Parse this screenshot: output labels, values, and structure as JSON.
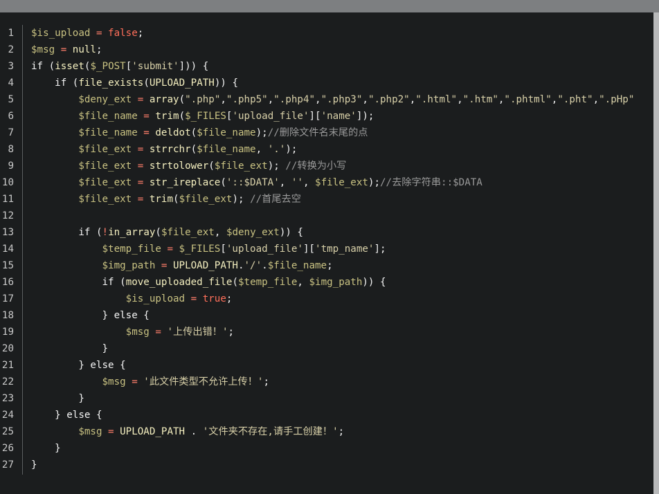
{
  "lines": [
    {
      "n": "1",
      "tokens": [
        {
          "t": "var",
          "v": "$is_upload"
        },
        {
          "t": "op",
          "v": " = "
        },
        {
          "t": "lit",
          "v": "false"
        },
        {
          "t": "pn",
          "v": ";"
        }
      ]
    },
    {
      "n": "2",
      "tokens": [
        {
          "t": "var",
          "v": "$msg"
        },
        {
          "t": "op",
          "v": " = "
        },
        {
          "t": "fn",
          "v": "null"
        },
        {
          "t": "pn",
          "v": ";"
        }
      ]
    },
    {
      "n": "3",
      "tokens": [
        {
          "t": "kw",
          "v": "if"
        },
        {
          "t": "pn",
          "v": " ("
        },
        {
          "t": "fn",
          "v": "isset"
        },
        {
          "t": "pn",
          "v": "("
        },
        {
          "t": "var",
          "v": "$_POST"
        },
        {
          "t": "pn",
          "v": "["
        },
        {
          "t": "str",
          "v": "'submit'"
        },
        {
          "t": "pn",
          "v": "])) {"
        }
      ]
    },
    {
      "n": "4",
      "tokens": [
        {
          "t": "pn",
          "v": "    "
        },
        {
          "t": "kw",
          "v": "if"
        },
        {
          "t": "pn",
          "v": " ("
        },
        {
          "t": "fn",
          "v": "file_exists"
        },
        {
          "t": "pn",
          "v": "("
        },
        {
          "t": "fn",
          "v": "UPLOAD_PATH"
        },
        {
          "t": "pn",
          "v": ")) {"
        }
      ]
    },
    {
      "n": "5",
      "tokens": [
        {
          "t": "pn",
          "v": "        "
        },
        {
          "t": "var",
          "v": "$deny_ext"
        },
        {
          "t": "op",
          "v": " = "
        },
        {
          "t": "fn",
          "v": "array"
        },
        {
          "t": "pn",
          "v": "("
        },
        {
          "t": "str",
          "v": "\".php\""
        },
        {
          "t": "pn",
          "v": ","
        },
        {
          "t": "str",
          "v": "\".php5\""
        },
        {
          "t": "pn",
          "v": ","
        },
        {
          "t": "str",
          "v": "\".php4\""
        },
        {
          "t": "pn",
          "v": ","
        },
        {
          "t": "str",
          "v": "\".php3\""
        },
        {
          "t": "pn",
          "v": ","
        },
        {
          "t": "str",
          "v": "\".php2\""
        },
        {
          "t": "pn",
          "v": ","
        },
        {
          "t": "str",
          "v": "\".html\""
        },
        {
          "t": "pn",
          "v": ","
        },
        {
          "t": "str",
          "v": "\".htm\""
        },
        {
          "t": "pn",
          "v": ","
        },
        {
          "t": "str",
          "v": "\".phtml\""
        },
        {
          "t": "pn",
          "v": ","
        },
        {
          "t": "str",
          "v": "\".pht\""
        },
        {
          "t": "pn",
          "v": ","
        },
        {
          "t": "str",
          "v": "\".pHp\""
        }
      ]
    },
    {
      "n": "6",
      "tokens": [
        {
          "t": "pn",
          "v": "        "
        },
        {
          "t": "var",
          "v": "$file_name"
        },
        {
          "t": "op",
          "v": " = "
        },
        {
          "t": "fn",
          "v": "trim"
        },
        {
          "t": "pn",
          "v": "("
        },
        {
          "t": "var",
          "v": "$_FILES"
        },
        {
          "t": "pn",
          "v": "["
        },
        {
          "t": "str",
          "v": "'upload_file'"
        },
        {
          "t": "pn",
          "v": "]["
        },
        {
          "t": "str",
          "v": "'name'"
        },
        {
          "t": "pn",
          "v": "]);"
        }
      ]
    },
    {
      "n": "7",
      "tokens": [
        {
          "t": "pn",
          "v": "        "
        },
        {
          "t": "var",
          "v": "$file_name"
        },
        {
          "t": "op",
          "v": " = "
        },
        {
          "t": "fn",
          "v": "deldot"
        },
        {
          "t": "pn",
          "v": "("
        },
        {
          "t": "var",
          "v": "$file_name"
        },
        {
          "t": "pn",
          "v": ");"
        },
        {
          "t": "cmt",
          "v": "//删除文件名末尾的点"
        }
      ]
    },
    {
      "n": "8",
      "tokens": [
        {
          "t": "pn",
          "v": "        "
        },
        {
          "t": "var",
          "v": "$file_ext"
        },
        {
          "t": "op",
          "v": " = "
        },
        {
          "t": "fn",
          "v": "strrchr"
        },
        {
          "t": "pn",
          "v": "("
        },
        {
          "t": "var",
          "v": "$file_name"
        },
        {
          "t": "pn",
          "v": ", "
        },
        {
          "t": "str",
          "v": "'.'"
        },
        {
          "t": "pn",
          "v": ");"
        }
      ]
    },
    {
      "n": "9",
      "tokens": [
        {
          "t": "pn",
          "v": "        "
        },
        {
          "t": "var",
          "v": "$file_ext"
        },
        {
          "t": "op",
          "v": " = "
        },
        {
          "t": "fn",
          "v": "strtolower"
        },
        {
          "t": "pn",
          "v": "("
        },
        {
          "t": "var",
          "v": "$file_ext"
        },
        {
          "t": "pn",
          "v": "); "
        },
        {
          "t": "cmt",
          "v": "//转换为小写"
        }
      ]
    },
    {
      "n": "10",
      "tokens": [
        {
          "t": "pn",
          "v": "        "
        },
        {
          "t": "var",
          "v": "$file_ext"
        },
        {
          "t": "op",
          "v": " = "
        },
        {
          "t": "fn",
          "v": "str_ireplace"
        },
        {
          "t": "pn",
          "v": "("
        },
        {
          "t": "str",
          "v": "'::$DATA'"
        },
        {
          "t": "pn",
          "v": ", "
        },
        {
          "t": "str",
          "v": "''"
        },
        {
          "t": "pn",
          "v": ", "
        },
        {
          "t": "var",
          "v": "$file_ext"
        },
        {
          "t": "pn",
          "v": ");"
        },
        {
          "t": "cmt",
          "v": "//去除字符串::$DATA"
        }
      ]
    },
    {
      "n": "11",
      "tokens": [
        {
          "t": "pn",
          "v": "        "
        },
        {
          "t": "var",
          "v": "$file_ext"
        },
        {
          "t": "op",
          "v": " = "
        },
        {
          "t": "fn",
          "v": "trim"
        },
        {
          "t": "pn",
          "v": "("
        },
        {
          "t": "var",
          "v": "$file_ext"
        },
        {
          "t": "pn",
          "v": "); "
        },
        {
          "t": "cmt",
          "v": "//首尾去空"
        }
      ]
    },
    {
      "n": "12",
      "tokens": []
    },
    {
      "n": "13",
      "tokens": [
        {
          "t": "pn",
          "v": "        "
        },
        {
          "t": "kw",
          "v": "if"
        },
        {
          "t": "pn",
          "v": " ("
        },
        {
          "t": "op",
          "v": "!"
        },
        {
          "t": "fn",
          "v": "in_array"
        },
        {
          "t": "pn",
          "v": "("
        },
        {
          "t": "var",
          "v": "$file_ext"
        },
        {
          "t": "pn",
          "v": ", "
        },
        {
          "t": "var",
          "v": "$deny_ext"
        },
        {
          "t": "pn",
          "v": ")) {"
        }
      ]
    },
    {
      "n": "14",
      "tokens": [
        {
          "t": "pn",
          "v": "            "
        },
        {
          "t": "var",
          "v": "$temp_file"
        },
        {
          "t": "op",
          "v": " = "
        },
        {
          "t": "var",
          "v": "$_FILES"
        },
        {
          "t": "pn",
          "v": "["
        },
        {
          "t": "str",
          "v": "'upload_file'"
        },
        {
          "t": "pn",
          "v": "]["
        },
        {
          "t": "str",
          "v": "'tmp_name'"
        },
        {
          "t": "pn",
          "v": "];"
        }
      ]
    },
    {
      "n": "15",
      "tokens": [
        {
          "t": "pn",
          "v": "            "
        },
        {
          "t": "var",
          "v": "$img_path"
        },
        {
          "t": "op",
          "v": " = "
        },
        {
          "t": "fn",
          "v": "UPLOAD_PATH"
        },
        {
          "t": "pn",
          "v": "."
        },
        {
          "t": "str",
          "v": "'/'"
        },
        {
          "t": "pn",
          "v": "."
        },
        {
          "t": "var",
          "v": "$file_name"
        },
        {
          "t": "pn",
          "v": ";"
        }
      ]
    },
    {
      "n": "16",
      "tokens": [
        {
          "t": "pn",
          "v": "            "
        },
        {
          "t": "kw",
          "v": "if"
        },
        {
          "t": "pn",
          "v": " ("
        },
        {
          "t": "fn",
          "v": "move_uploaded_file"
        },
        {
          "t": "pn",
          "v": "("
        },
        {
          "t": "var",
          "v": "$temp_file"
        },
        {
          "t": "pn",
          "v": ", "
        },
        {
          "t": "var",
          "v": "$img_path"
        },
        {
          "t": "pn",
          "v": ")) {"
        }
      ]
    },
    {
      "n": "17",
      "tokens": [
        {
          "t": "pn",
          "v": "                "
        },
        {
          "t": "var",
          "v": "$is_upload"
        },
        {
          "t": "op",
          "v": " = "
        },
        {
          "t": "lit",
          "v": "true"
        },
        {
          "t": "pn",
          "v": ";"
        }
      ]
    },
    {
      "n": "18",
      "tokens": [
        {
          "t": "pn",
          "v": "            } "
        },
        {
          "t": "kw",
          "v": "else"
        },
        {
          "t": "pn",
          "v": " {"
        }
      ]
    },
    {
      "n": "19",
      "tokens": [
        {
          "t": "pn",
          "v": "                "
        },
        {
          "t": "var",
          "v": "$msg"
        },
        {
          "t": "op",
          "v": " = "
        },
        {
          "t": "str",
          "v": "'上传出错！'"
        },
        {
          "t": "pn",
          "v": ";"
        }
      ]
    },
    {
      "n": "20",
      "tokens": [
        {
          "t": "pn",
          "v": "            }"
        }
      ]
    },
    {
      "n": "21",
      "tokens": [
        {
          "t": "pn",
          "v": "        } "
        },
        {
          "t": "kw",
          "v": "else"
        },
        {
          "t": "pn",
          "v": " {"
        }
      ]
    },
    {
      "n": "22",
      "tokens": [
        {
          "t": "pn",
          "v": "            "
        },
        {
          "t": "var",
          "v": "$msg"
        },
        {
          "t": "op",
          "v": " = "
        },
        {
          "t": "str",
          "v": "'此文件类型不允许上传！'"
        },
        {
          "t": "pn",
          "v": ";"
        }
      ]
    },
    {
      "n": "23",
      "tokens": [
        {
          "t": "pn",
          "v": "        }"
        }
      ]
    },
    {
      "n": "24",
      "tokens": [
        {
          "t": "pn",
          "v": "    } "
        },
        {
          "t": "kw",
          "v": "else"
        },
        {
          "t": "pn",
          "v": " {"
        }
      ]
    },
    {
      "n": "25",
      "tokens": [
        {
          "t": "pn",
          "v": "        "
        },
        {
          "t": "var",
          "v": "$msg"
        },
        {
          "t": "op",
          "v": " = "
        },
        {
          "t": "fn",
          "v": "UPLOAD_PATH"
        },
        {
          "t": "pn",
          "v": " . "
        },
        {
          "t": "str",
          "v": "'文件夹不存在,请手工创建！'"
        },
        {
          "t": "pn",
          "v": ";"
        }
      ]
    },
    {
      "n": "26",
      "tokens": [
        {
          "t": "pn",
          "v": "    }"
        }
      ]
    },
    {
      "n": "27",
      "tokens": [
        {
          "t": "pn",
          "v": "}"
        }
      ]
    }
  ]
}
